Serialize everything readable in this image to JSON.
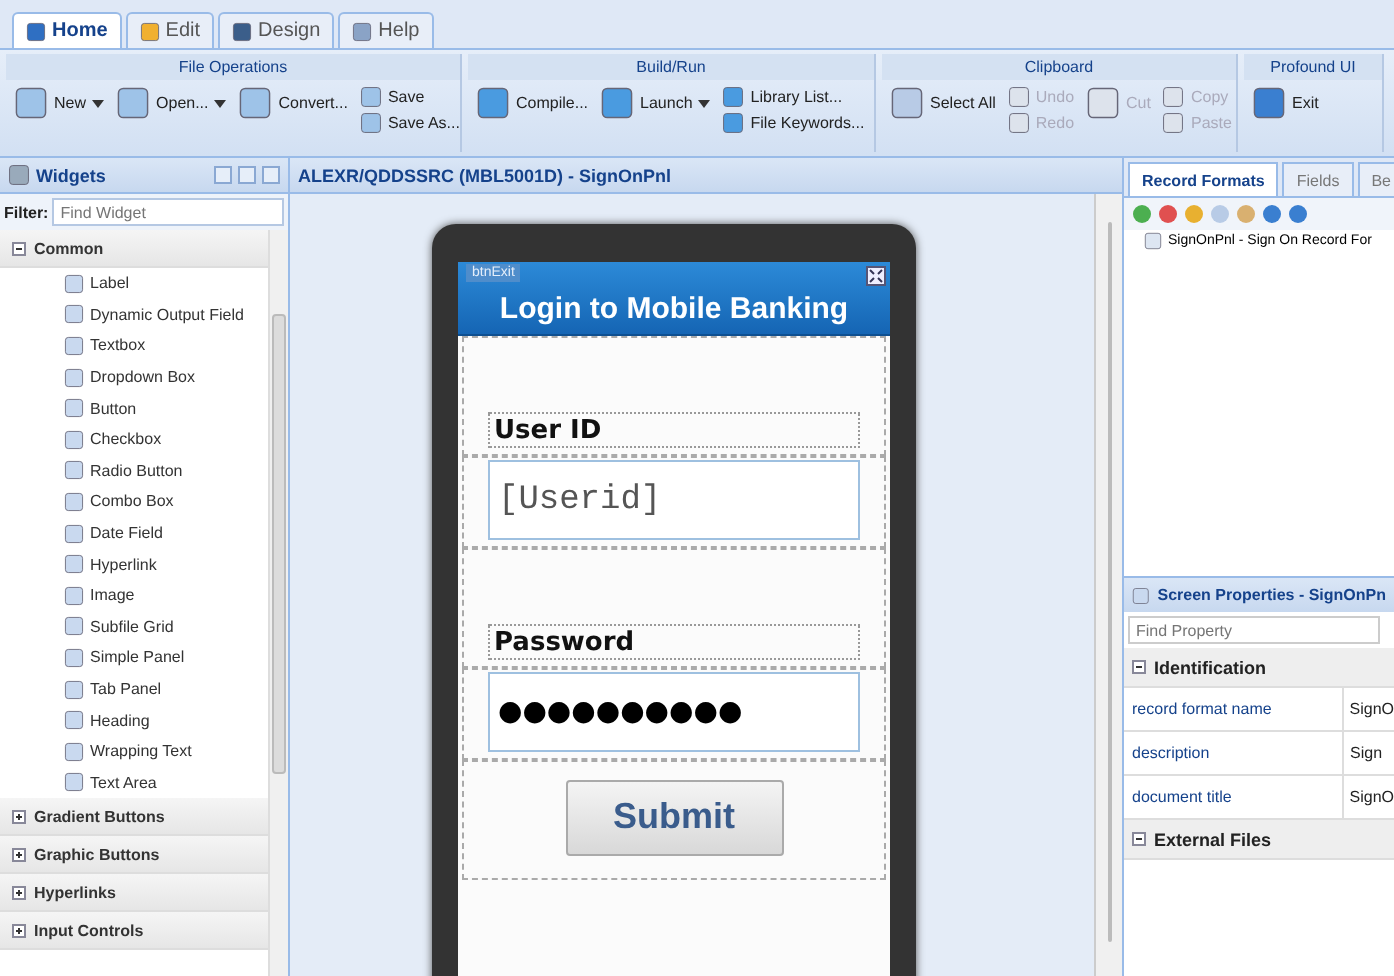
{
  "ribbon_tabs": [
    {
      "label": "Home",
      "selected": true
    },
    {
      "label": "Edit",
      "selected": false
    },
    {
      "label": "Design",
      "selected": false
    },
    {
      "label": "Help",
      "selected": false
    }
  ],
  "ribbon_groups": [
    {
      "title": "File Operations",
      "columns": [
        [
          {
            "label": "New",
            "disabled": false,
            "dropdown": true
          }
        ],
        [
          {
            "label": "Open...",
            "disabled": false,
            "dropdown": true
          }
        ],
        [
          {
            "label": "Convert...",
            "disabled": false,
            "dropdown": false
          }
        ],
        [
          {
            "label": "Save",
            "disabled": false,
            "dropdown": false
          },
          {
            "label": "Save As...",
            "disabled": false,
            "dropdown": false
          }
        ]
      ]
    },
    {
      "title": "Build/Run",
      "columns": [
        [
          {
            "label": "Compile...",
            "disabled": false,
            "dropdown": false
          }
        ],
        [
          {
            "label": "Launch",
            "disabled": false,
            "dropdown": true
          }
        ],
        [
          {
            "label": "Library List...",
            "disabled": false,
            "dropdown": false
          },
          {
            "label": "File Keywords...",
            "disabled": false,
            "dropdown": false
          }
        ]
      ]
    },
    {
      "title": "Clipboard",
      "columns": [
        [
          {
            "label": "Select All",
            "disabled": false,
            "dropdown": false
          }
        ],
        [
          {
            "label": "Undo",
            "disabled": true,
            "dropdown": false
          },
          {
            "label": "Redo",
            "disabled": true,
            "dropdown": false
          }
        ],
        [
          {
            "label": "Cut",
            "disabled": true,
            "dropdown": false
          }
        ],
        [
          {
            "label": "Copy",
            "disabled": true,
            "dropdown": false
          },
          {
            "label": "Paste",
            "disabled": true,
            "dropdown": false
          }
        ]
      ]
    },
    {
      "title": "Profound UI",
      "columns": [
        [
          {
            "label": "Exit",
            "disabled": false,
            "dropdown": false
          }
        ]
      ]
    }
  ],
  "widgets_panel": {
    "title": "Widgets",
    "filter_label": "Filter:",
    "filter_placeholder": "Find Widget",
    "categories": [
      {
        "label": "Common",
        "expanded": true,
        "items": [
          "Label",
          "Dynamic Output Field",
          "Textbox",
          "Dropdown Box",
          "Button",
          "Checkbox",
          "Radio Button",
          "Combo Box",
          "Date Field",
          "Hyperlink",
          "Image",
          "Subfile Grid",
          "Simple Panel",
          "Tab Panel",
          "Heading",
          "Wrapping Text",
          "Text Area"
        ]
      },
      {
        "label": "Gradient Buttons",
        "expanded": false
      },
      {
        "label": "Graphic Buttons",
        "expanded": false
      },
      {
        "label": "Hyperlinks",
        "expanded": false
      },
      {
        "label": "Input Controls",
        "expanded": false
      }
    ]
  },
  "designer": {
    "title": "ALEXR/QDDSSRC (MBL5001D) - SignOnPnl",
    "screen": {
      "hidden_label": "btnExit",
      "heading": "Login to Mobile Banking",
      "userid_label": "User ID",
      "userid_value": "[Userid]",
      "password_label": "Password",
      "password_value": "●●●●●●●●●●",
      "button": "Submit"
    }
  },
  "record_tabs": [
    {
      "label": "Record Formats",
      "selected": true
    },
    {
      "label": "Fields",
      "selected": false
    },
    {
      "label": "Be",
      "selected": false
    }
  ],
  "record_formats": [
    "SignOnPnl - Sign On Record For"
  ],
  "properties": {
    "title": "Screen Properties - SignOnPn",
    "search_placeholder": "Find Property",
    "sections": [
      {
        "label": "Identification",
        "expanded": true,
        "rows": [
          {
            "name": "record format name",
            "value": "SignO"
          },
          {
            "name": "description",
            "value": "Sign"
          },
          {
            "name": "document title",
            "value": "SignO"
          }
        ]
      },
      {
        "label": "External Files",
        "expanded": true
      }
    ]
  }
}
